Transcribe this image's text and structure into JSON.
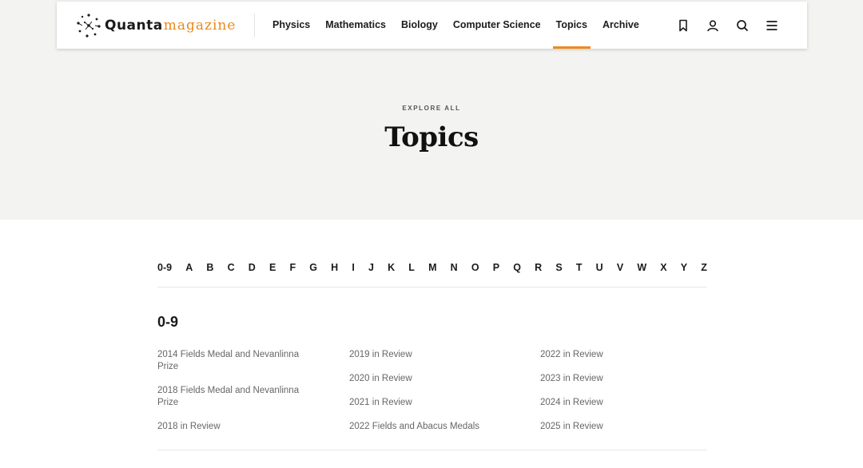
{
  "header": {
    "logo_text_1": "Quanta",
    "logo_text_2": "magazine",
    "nav": [
      "Physics",
      "Mathematics",
      "Biology",
      "Computer Science",
      "Topics",
      "Archive"
    ],
    "active_nav": "Topics",
    "icons": [
      "bookmark-icon",
      "user-icon",
      "search-icon",
      "menu-icon"
    ]
  },
  "hero": {
    "eyebrow": "EXPLORE ALL",
    "title": "Topics"
  },
  "alphabet": [
    "0-9",
    "A",
    "B",
    "C",
    "D",
    "E",
    "F",
    "G",
    "H",
    "I",
    "J",
    "K",
    "L",
    "M",
    "N",
    "O",
    "P",
    "Q",
    "R",
    "S",
    "T",
    "U",
    "V",
    "W",
    "X",
    "Y",
    "Z"
  ],
  "section": {
    "title": "0-9",
    "columns": [
      [
        "2014 Fields Medal and Nevanlinna Prize",
        "2018 Fields Medal and Nevanlinna Prize",
        "2018 in Review"
      ],
      [
        "2019 in Review",
        "2020 in Review",
        "2021 in Review",
        "2022 Fields and Abacus Medals"
      ],
      [
        "2022 in Review",
        "2023 in Review",
        "2024 in Review",
        "2025 in Review"
      ]
    ]
  },
  "colors": {
    "accent": "#f08a1b",
    "logo_accent": "#e8891c",
    "hero_bg": "#f3f3f2",
    "link": "#666666"
  }
}
